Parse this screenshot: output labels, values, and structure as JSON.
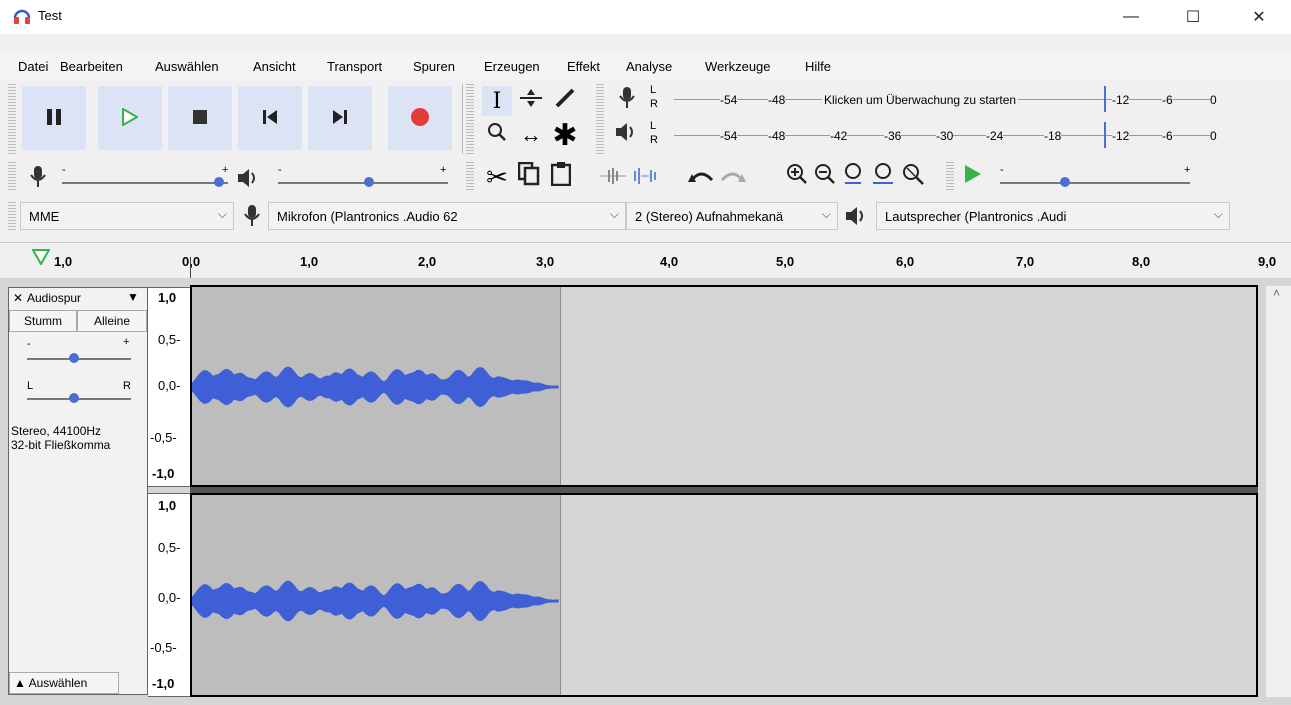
{
  "window": {
    "title": "Test",
    "minimize": "—",
    "maximize": "☐",
    "close": "✕"
  },
  "menu": [
    "Datei",
    "Bearbeiten",
    "Auswählen",
    "Ansicht",
    "Transport",
    "Spuren",
    "Erzeugen",
    "Effekt",
    "Analyse",
    "Werkzeuge",
    "Hilfe"
  ],
  "meters": {
    "record": {
      "ch_top": "L",
      "ch_bottom": "R",
      "labels": [
        "-54",
        "-48"
      ],
      "hint": "Klicken um Überwachung zu starten",
      "right_labels": [
        "-12",
        "-6",
        "0"
      ]
    },
    "play": {
      "ch_top": "L",
      "ch_bottom": "R",
      "labels": [
        "-54",
        "-48",
        "-42",
        "-36",
        "-30",
        "-24",
        "-18",
        "-12",
        "-6",
        "0"
      ]
    }
  },
  "mixer": {
    "rec_minus": "-",
    "rec_plus": "+",
    "play_minus": "-",
    "play_plus": "+",
    "speed_minus": "-",
    "speed_plus": "+"
  },
  "devices": {
    "host": "MME",
    "input": "Mikrofon (Plantronics .Audio 62",
    "channels": "2 (Stereo) Aufnahmekanä",
    "output": "Lautsprecher (Plantronics .Audi"
  },
  "ruler": {
    "left_label": "1,0",
    "labels": [
      "0,0",
      "1,0",
      "2,0",
      "3,0",
      "4,0",
      "5,0",
      "6,0",
      "7,0",
      "8,0",
      "9,0"
    ]
  },
  "track": {
    "name": "Audiospur",
    "mute": "Stumm",
    "solo": "Alleine",
    "gain_minus": "-",
    "gain_plus": "+",
    "pan_left": "L",
    "pan_right": "R",
    "info_line1": "Stereo, 44100Hz",
    "info_line2": "32-bit Fließkomma",
    "select": "Auswählen",
    "scale": [
      "1,0",
      "0,5-",
      "0,0-",
      "-0,5-",
      "-1,0"
    ]
  }
}
